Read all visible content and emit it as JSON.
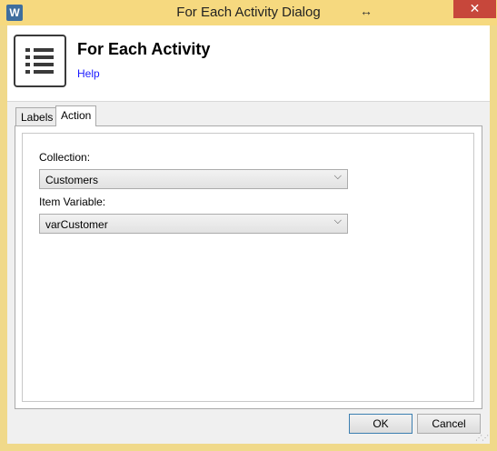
{
  "window": {
    "title": "For Each Activity Dialog",
    "app_icon_letter": "W",
    "resize_glyph": "↔",
    "close_glyph": "✕"
  },
  "header": {
    "title": "For Each Activity",
    "help_label": "Help",
    "icon": "list-icon"
  },
  "tabs": [
    {
      "label": "Labels",
      "active": false
    },
    {
      "label": "Action",
      "active": true
    }
  ],
  "form": {
    "collection_label": "Collection:",
    "collection_value": "Customers",
    "item_variable_label": "Item Variable:",
    "item_variable_value": "varCustomer"
  },
  "buttons": {
    "ok_label": "OK",
    "cancel_label": "Cancel"
  },
  "colors": {
    "titlebar": "#f6d97f",
    "close_button": "#c7473b",
    "link": "#1a1aff"
  }
}
